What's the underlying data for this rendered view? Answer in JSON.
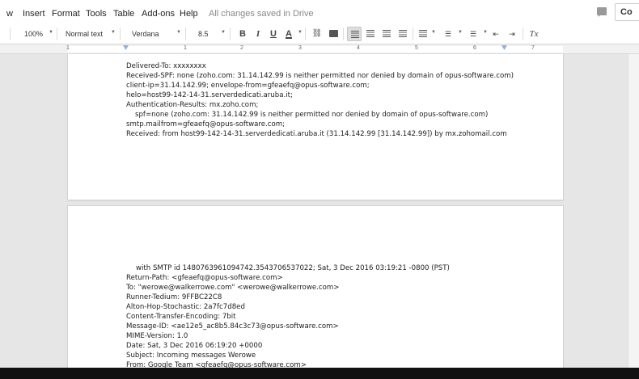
{
  "menu": {
    "items": [
      "w",
      "Insert",
      "Format",
      "Tools",
      "Table",
      "Add-ons",
      "Help"
    ],
    "save_status": "All changes saved in Drive",
    "comments_label": "Co"
  },
  "toolbar": {
    "zoom": "100%",
    "style": "Normal text",
    "font": "Verdana",
    "size": "8.5",
    "bold": "B",
    "italic": "I",
    "underline": "U",
    "text_color": "A",
    "clear_format": "Tx"
  },
  "ruler": {
    "numbers": [
      "1",
      "1",
      "2",
      "3",
      "4",
      "5",
      "6",
      "7"
    ]
  },
  "page1": {
    "lines": [
      "Delivered-To: xxxxxxxx",
      "Received-SPF: none (zoho.com: 31.14.142.99 is neither permitted nor denied by domain of opus-software.com)",
      "client-ip=31.14.142.99; envelope-from=gfeaefq@opus-software.com;",
      "helo=host99-142-14-31.serverdedicati.aruba.it;",
      "Authentication-Results: mx.zoho.com;",
      "spf=none (zoho.com: 31.14.142.99 is neither permitted nor denied by domain of opus-software.com)",
      "smtp.mailfrom=gfeaefq@opus-software.com;",
      "Received: from host99-142-14-31.serverdedicati.aruba.it (31.14.142.99 [31.14.142.99]) by mx.zohomail.com"
    ]
  },
  "page2": {
    "lines": [
      "with SMTP id 1480763961094742.3543706537022; Sat, 3 Dec 2016 03:19:21 -0800 (PST)",
      "Return-Path: <gfeaefq@opus-software.com>",
      "To: \"werowe@walkerrowe.com\" <werowe@walkerrowe.com>",
      "Runner-Tedium: 9FFBC22C8",
      "Alton-Hop-Stochastic: 2a7fc7d8ed",
      "Content-Transfer-Encoding: 7bit",
      "Message-ID: <ae12e5_ac8b5.84c3c73@opus-software.com>",
      "MIME-Version: 1.0",
      "Date: Sat, 3 Dec 2016 06:19:20 +0000",
      "Subject: Incoming messages Werowe",
      "From: Google Team <gfeaefq@opus-software.com>"
    ]
  }
}
